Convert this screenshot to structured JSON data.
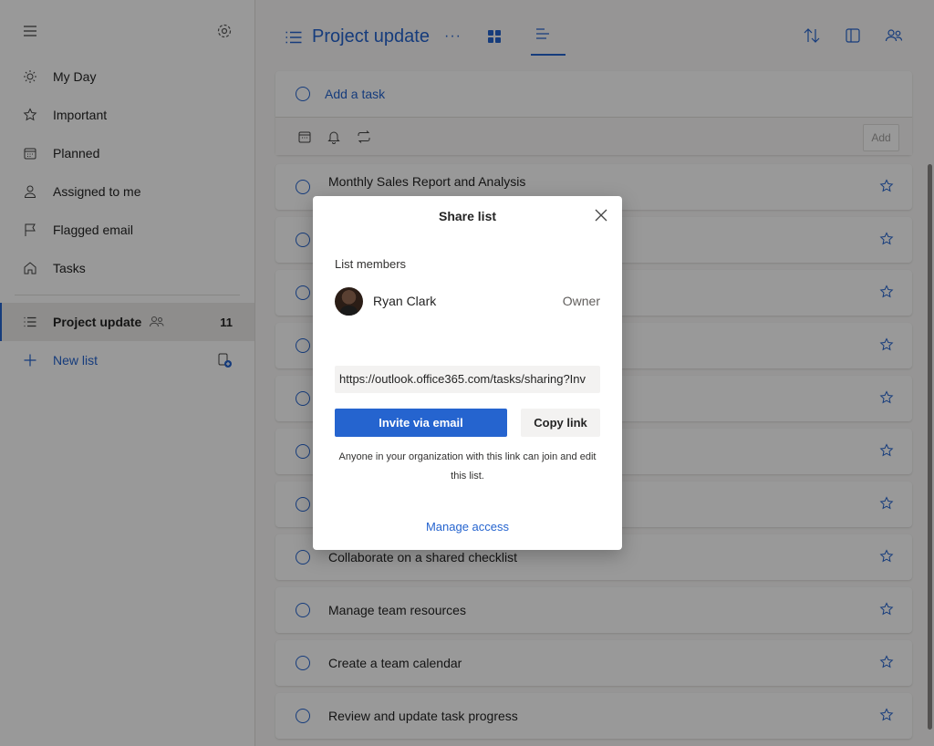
{
  "sidebar": {
    "items": [
      {
        "label": "My Day",
        "icon": "sun-icon"
      },
      {
        "label": "Important",
        "icon": "star-icon"
      },
      {
        "label": "Planned",
        "icon": "calendar-icon"
      },
      {
        "label": "Assigned to me",
        "icon": "person-icon"
      },
      {
        "label": "Flagged email",
        "icon": "flag-icon"
      },
      {
        "label": "Tasks",
        "icon": "home-icon"
      }
    ],
    "active_list": {
      "label": "Project update",
      "count": "11"
    },
    "new_list": "New list"
  },
  "header": {
    "title": "Project update",
    "more": "···"
  },
  "add_task": {
    "placeholder": "Add a task",
    "add_button": "Add"
  },
  "tasks": [
    {
      "title": "Monthly Sales Report and Analysis",
      "sub": ""
    },
    {
      "title": ""
    },
    {
      "title": ""
    },
    {
      "title": ""
    },
    {
      "title": ""
    },
    {
      "title": ""
    },
    {
      "title": ""
    },
    {
      "title": "Collaborate on a shared checklist"
    },
    {
      "title": "Manage team resources"
    },
    {
      "title": "Create a team calendar"
    },
    {
      "title": "Review and update task progress"
    }
  ],
  "dialog": {
    "title": "Share list",
    "members_label": "List members",
    "member": {
      "name": "Ryan Clark",
      "role": "Owner"
    },
    "link": "https://outlook.office365.com/tasks/sharing?Inv",
    "invite_button": "Invite via email",
    "copy_button": "Copy link",
    "note": "Anyone in your organization with this link can join and edit this list.",
    "manage_access": "Manage access"
  },
  "colors": {
    "accent": "#2564cf",
    "overlay": "rgba(0,0,0,0.4)"
  }
}
